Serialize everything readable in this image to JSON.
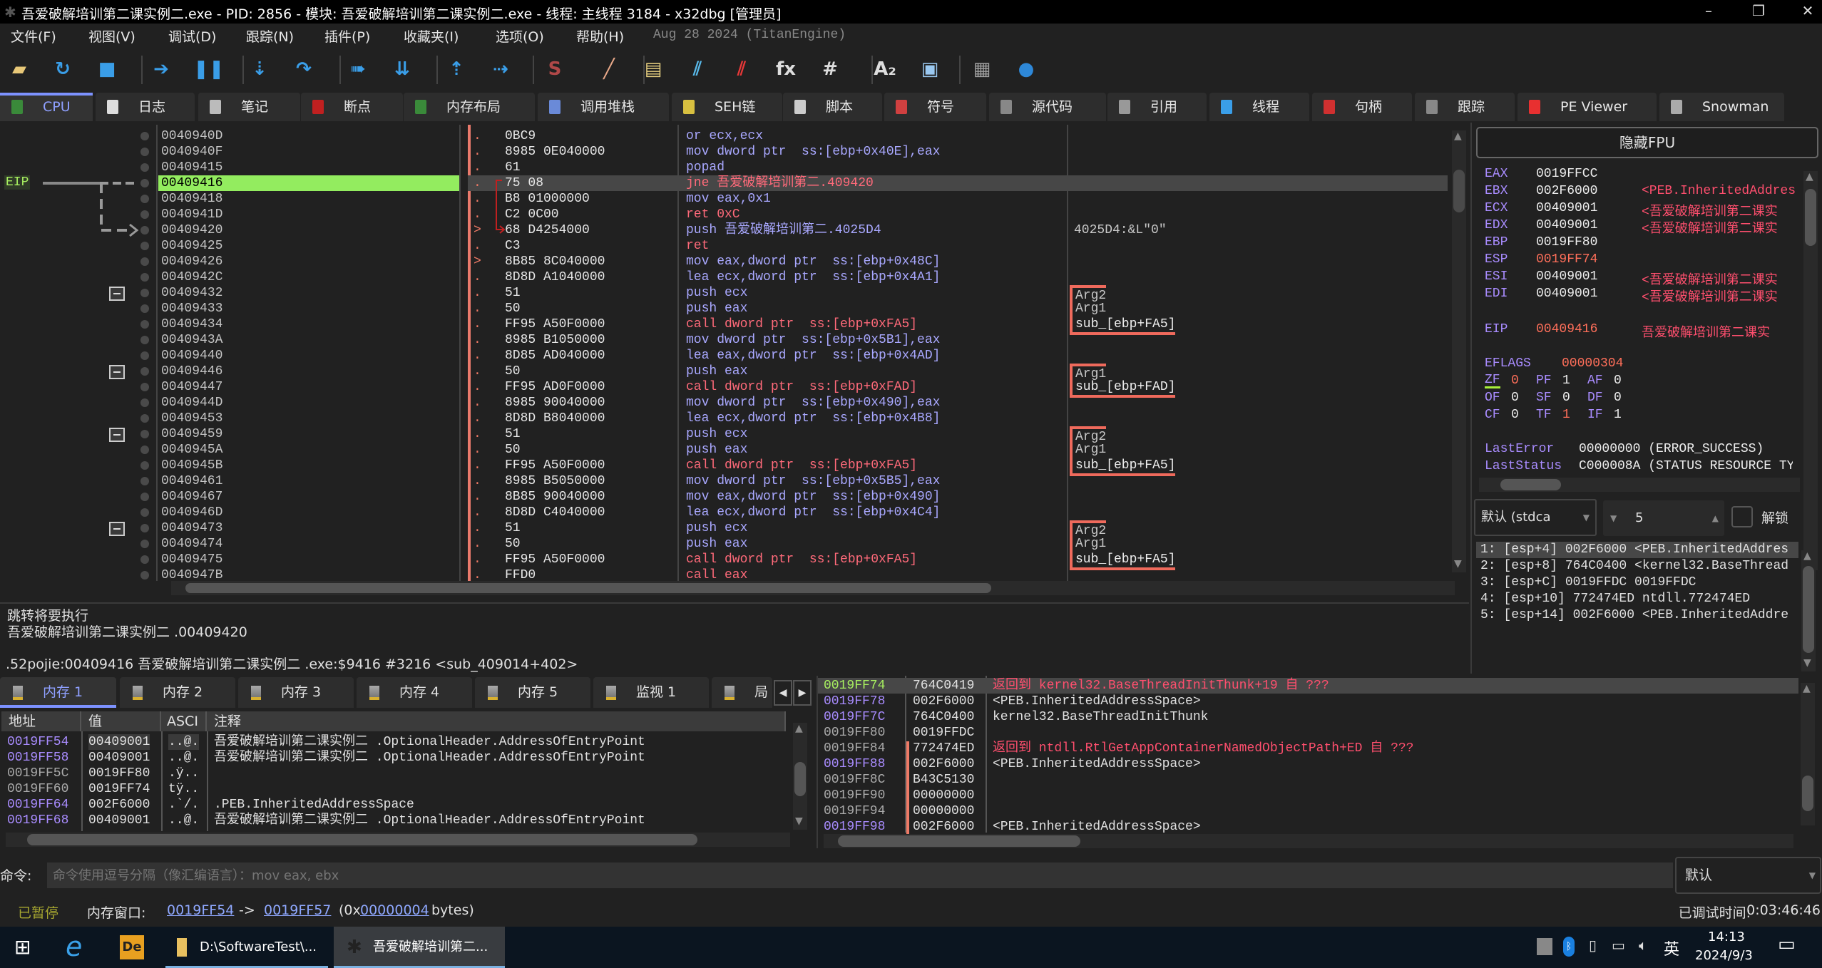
{
  "window": {
    "title": "吾爱破解培训第二课实例二.exe - PID: 2856 - 模块: 吾爱破解培训第二课实例二.exe - 线程: 主线程 3184 - x32dbg [管理员]",
    "app_icon": "bug-icon"
  },
  "menu": {
    "items": [
      "文件(F)",
      "视图(V)",
      "调试(D)",
      "跟踪(N)",
      "插件(P)",
      "收藏夹(I)",
      "选项(O)",
      "帮助(H)"
    ],
    "build_info": "Aug 28 2024 (TitanEngine)"
  },
  "toolbar": [
    {
      "icon": "open-icon",
      "glyph": "▰",
      "color": "#e8c878"
    },
    {
      "icon": "restart-icon",
      "glyph": "↻",
      "color": "#3a9ee8"
    },
    {
      "icon": "stop-icon",
      "glyph": "■",
      "color": "#3a9ee8"
    },
    {
      "icon": "run-icon",
      "glyph": "➔",
      "color": "#3a9ee8"
    },
    {
      "icon": "pause-icon",
      "glyph": "❚❚",
      "color": "#3a9ee8"
    },
    {
      "icon": "step-into-icon",
      "glyph": "⇣",
      "color": "#3a9ee8"
    },
    {
      "icon": "step-over-icon",
      "glyph": "↷",
      "color": "#3a9ee8"
    },
    {
      "icon": "trace-into-icon",
      "glyph": "➠",
      "color": "#3a9ee8"
    },
    {
      "icon": "trace-over-icon",
      "glyph": "⇊",
      "color": "#3a9ee8"
    },
    {
      "icon": "execute-till-return-icon",
      "glyph": "⇡",
      "color": "#3a9ee8"
    },
    {
      "icon": "run-to-user-code-icon",
      "glyph": "⇢",
      "color": "#3a9ee8"
    },
    {
      "icon": "scylla-icon",
      "glyph": "S",
      "color": "#b04848"
    },
    {
      "icon": "patch-icon",
      "glyph": "╱",
      "color": "#e8a888"
    },
    {
      "icon": "comments-icon",
      "glyph": "▤",
      "color": "#e8d080"
    },
    {
      "icon": "labels-icon",
      "glyph": "⫽",
      "color": "#58b8e8"
    },
    {
      "icon": "bookmarks-icon",
      "glyph": "⫽",
      "color": "#e83838"
    },
    {
      "icon": "functions-icon",
      "glyph": "fx",
      "color": "#dddddd"
    },
    {
      "icon": "hash-icon",
      "glyph": "#",
      "color": "#dddddd"
    },
    {
      "icon": "font-icon",
      "glyph": "A₂",
      "color": "#dddddd"
    },
    {
      "icon": "device-icon",
      "glyph": "▣",
      "color": "#9ac8f0"
    },
    {
      "icon": "calculator-icon",
      "glyph": "▦",
      "color": "#a0a0a0"
    },
    {
      "icon": "globe-icon",
      "glyph": "●",
      "color": "#2e88d8"
    }
  ],
  "tabs": [
    {
      "label": "CPU",
      "icon": "cpu-icon",
      "color": "#3a8a3a",
      "active": true
    },
    {
      "label": "日志",
      "icon": "log-icon",
      "color": "#ddd"
    },
    {
      "label": "笔记",
      "icon": "notes-icon",
      "color": "#bbb"
    },
    {
      "label": "断点",
      "icon": "breakpoint-icon",
      "color": "#c02020"
    },
    {
      "label": "内存布局",
      "icon": "memory-map-icon",
      "color": "#3a8a3a"
    },
    {
      "label": "调用堆栈",
      "icon": "call-stack-icon",
      "color": "#6a8ad8"
    },
    {
      "label": "SEH链",
      "icon": "seh-icon",
      "color": "#d8c040"
    },
    {
      "label": "脚本",
      "icon": "script-icon",
      "color": "#ccc"
    },
    {
      "label": "符号",
      "icon": "symbols-icon",
      "color": "#d04040"
    },
    {
      "label": "源代码",
      "icon": "source-icon",
      "color": "#888"
    },
    {
      "label": "引用",
      "icon": "references-icon",
      "color": "#999"
    },
    {
      "label": "线程",
      "icon": "threads-icon",
      "color": "#3a9ee8"
    },
    {
      "label": "句柄",
      "icon": "handles-icon",
      "color": "#d03030"
    },
    {
      "label": "跟踪",
      "icon": "trace-icon",
      "color": "#888"
    },
    {
      "label": "PE Viewer",
      "icon": "pe-viewer-icon",
      "color": "#e83030"
    },
    {
      "label": "Snowman",
      "icon": "snowman-icon",
      "color": "#aaa"
    }
  ],
  "disasm": {
    "eip_label": "EIP",
    "rows": [
      {
        "addr": "0040940D",
        "mark": ".",
        "bytes": "0BC9",
        "ins": "or ecx,ecx",
        "comment": ""
      },
      {
        "addr": "0040940F",
        "mark": ".",
        "bytes": "8985 0E040000",
        "ins": "mov dword ptr  ss:[ebp+0x40E],eax",
        "comment": ""
      },
      {
        "addr": "00409415",
        "mark": ".",
        "bytes": "61",
        "ins": "popad",
        "comment": ""
      },
      {
        "addr": "00409416",
        "mark": ".",
        "bytes": "75 08",
        "ins": "jne 吾爱破解培训第二.409420",
        "comment": "",
        "eip": true
      },
      {
        "addr": "00409418",
        "mark": ".",
        "bytes": "B8 01000000",
        "ins": "mov eax,0x1",
        "comment": ""
      },
      {
        "addr": "0040941D",
        "mark": ".",
        "bytes": "C2 0C00",
        "ins": "ret 0xC",
        "comment": ""
      },
      {
        "addr": "00409420",
        "mark": ">",
        "bytes": "68 D4254000",
        "ins": "push 吾爱破解培训第二.4025D4",
        "comment": "4025D4:&L\"0\""
      },
      {
        "addr": "00409425",
        "mark": ".",
        "bytes": "C3",
        "ins": "ret",
        "comment": ""
      },
      {
        "addr": "00409426",
        "mark": ">",
        "bytes": "8B85 8C040000",
        "ins": "mov eax,dword ptr  ss:[ebp+0x48C]",
        "comment": ""
      },
      {
        "addr": "0040942C",
        "mark": ".",
        "bytes": "8D8D A1040000",
        "ins": "lea ecx,dword ptr  ss:[ebp+0x4A1]",
        "comment": ""
      },
      {
        "addr": "00409432",
        "mark": ".",
        "bytes": "51",
        "ins": "push ecx",
        "comment": "Arg2",
        "bracket": "top",
        "fold": true
      },
      {
        "addr": "00409433",
        "mark": ".",
        "bytes": "50",
        "ins": "push eax",
        "comment": "Arg1",
        "bracket": "mid"
      },
      {
        "addr": "00409434",
        "mark": ".",
        "bytes": "FF95 A50F0000",
        "ins": "call dword ptr  ss:[ebp+0xFA5]",
        "comment": "sub_[ebp+FA5]",
        "bracket": "bottom"
      },
      {
        "addr": "0040943A",
        "mark": ".",
        "bytes": "8985 B1050000",
        "ins": "mov dword ptr  ss:[ebp+0x5B1],eax",
        "comment": ""
      },
      {
        "addr": "00409440",
        "mark": ".",
        "bytes": "8D85 AD040000",
        "ins": "lea eax,dword ptr  ss:[ebp+0x4AD]",
        "comment": ""
      },
      {
        "addr": "00409446",
        "mark": ".",
        "bytes": "50",
        "ins": "push eax",
        "comment": "Arg1",
        "bracket": "top",
        "fold": true
      },
      {
        "addr": "00409447",
        "mark": ".",
        "bytes": "FF95 AD0F0000",
        "ins": "call dword ptr  ss:[ebp+0xFAD]",
        "comment": "sub_[ebp+FAD]",
        "bracket": "bottom"
      },
      {
        "addr": "0040944D",
        "mark": ".",
        "bytes": "8985 90040000",
        "ins": "mov dword ptr  ss:[ebp+0x490],eax",
        "comment": ""
      },
      {
        "addr": "00409453",
        "mark": ".",
        "bytes": "8D8D B8040000",
        "ins": "lea ecx,dword ptr  ss:[ebp+0x4B8]",
        "comment": ""
      },
      {
        "addr": "00409459",
        "mark": ".",
        "bytes": "51",
        "ins": "push ecx",
        "comment": "Arg2",
        "bracket": "top",
        "fold": true
      },
      {
        "addr": "0040945A",
        "mark": ".",
        "bytes": "50",
        "ins": "push eax",
        "comment": "Arg1",
        "bracket": "mid"
      },
      {
        "addr": "0040945B",
        "mark": ".",
        "bytes": "FF95 A50F0000",
        "ins": "call dword ptr  ss:[ebp+0xFA5]",
        "comment": "sub_[ebp+FA5]",
        "bracket": "bottom"
      },
      {
        "addr": "00409461",
        "mark": ".",
        "bytes": "8985 B5050000",
        "ins": "mov dword ptr  ss:[ebp+0x5B5],eax",
        "comment": ""
      },
      {
        "addr": "00409467",
        "mark": ".",
        "bytes": "8B85 90040000",
        "ins": "mov eax,dword ptr  ss:[ebp+0x490]",
        "comment": ""
      },
      {
        "addr": "0040946D",
        "mark": ".",
        "bytes": "8D8D C4040000",
        "ins": "lea ecx,dword ptr  ss:[ebp+0x4C4]",
        "comment": ""
      },
      {
        "addr": "00409473",
        "mark": ".",
        "bytes": "51",
        "ins": "push ecx",
        "comment": "Arg2",
        "bracket": "top",
        "fold": true
      },
      {
        "addr": "00409474",
        "mark": ".",
        "bytes": "50",
        "ins": "push eax",
        "comment": "Arg1",
        "bracket": "mid"
      },
      {
        "addr": "00409475",
        "mark": ".",
        "bytes": "FF95 A50F0000",
        "ins": "call dword ptr  ss:[ebp+0xFA5]",
        "comment": "sub_[ebp+FA5]",
        "bracket": "bottom"
      },
      {
        "addr": "0040947B",
        "mark": ".",
        "bytes": "FFD0",
        "ins": "call eax",
        "comment": ""
      }
    ]
  },
  "info": {
    "lines": [
      "跳转将要执行",
      "吾爱破解培训第二课实例二 .00409420"
    ],
    "location": ".52pojie:00409416 吾爱破解培训第二课实例二 .exe:$9416 #3216 <sub_409014+402>"
  },
  "registers": {
    "hide_fpu": "隐藏FPU",
    "gp": [
      {
        "name": "EAX",
        "value": "0019FFCC",
        "comment": ""
      },
      {
        "name": "EBX",
        "value": "002F6000",
        "comment": "<PEB.InheritedAddres"
      },
      {
        "name": "ECX",
        "value": "00409001",
        "comment": "<吾爱破解培训第二课实"
      },
      {
        "name": "EDX",
        "value": "00409001",
        "comment": "<吾爱破解培训第二课实"
      },
      {
        "name": "EBP",
        "value": "0019FF80",
        "comment": ""
      },
      {
        "name": "ESP",
        "value": "0019FF74",
        "comment": "",
        "changed": true
      },
      {
        "name": "ESI",
        "value": "00409001",
        "comment": "<吾爱破解培训第二课实"
      },
      {
        "name": "EDI",
        "value": "00409001",
        "comment": "<吾爱破解培训第二课实"
      }
    ],
    "eip": {
      "name": "EIP",
      "value": "00409416",
      "comment": "吾爱破解培训第二课实"
    },
    "eflags": {
      "name": "EFLAGS",
      "value": "00000304"
    },
    "flags": [
      [
        {
          "name": "ZF",
          "value": "0",
          "changed": true
        },
        {
          "name": "PF",
          "value": "1"
        },
        {
          "name": "AF",
          "value": "0"
        }
      ],
      [
        {
          "name": "OF",
          "value": "0"
        },
        {
          "name": "SF",
          "value": "0"
        },
        {
          "name": "DF",
          "value": "0"
        }
      ],
      [
        {
          "name": "CF",
          "value": "0"
        },
        {
          "name": "TF",
          "value": "1",
          "changed": true
        },
        {
          "name": "IF",
          "value": "1"
        }
      ]
    ],
    "last_error": {
      "name": "LastError",
      "value": "00000000 (ERROR_SUCCESS)"
    },
    "last_status": {
      "name": "LastStatus",
      "value": "C000008A (STATUS RESOURCE TY"
    }
  },
  "callstack": {
    "convention": "默认 (stdca",
    "count": "5",
    "unlock": "解锁",
    "unlocked": false,
    "rows": [
      "1: [esp+4] 002F6000 <PEB.InheritedAddres",
      "2: [esp+8] 764C0400 <kernel32.BaseThread",
      "3: [esp+C] 0019FFDC 0019FFDC",
      "4: [esp+10] 772474ED ntdll.772474ED",
      "5: [esp+14] 002F6000 <PEB.InheritedAddre"
    ]
  },
  "dump_tabs": [
    {
      "label": "内存 1",
      "icon": "memory-icon",
      "active": true
    },
    {
      "label": "内存 2",
      "icon": "memory-icon"
    },
    {
      "label": "内存 3",
      "icon": "memory-icon"
    },
    {
      "label": "内存 4",
      "icon": "memory-icon"
    },
    {
      "label": "内存 5",
      "icon": "memory-icon"
    },
    {
      "label": "监视 1",
      "icon": "watch-icon"
    },
    {
      "label": "局",
      "icon": "locals-icon"
    }
  ],
  "dump": {
    "headers": [
      "地址",
      "值",
      "ASCI",
      "注释"
    ],
    "rows": [
      {
        "addr": "0019FF54",
        "value": "00409001",
        "ascii": "..@.",
        "comment": "吾爱破解培训第二课实例二 .OptionalHeader.AddressOfEntryPoint",
        "kind": "pointer"
      },
      {
        "addr": "0019FF58",
        "value": "00409001",
        "ascii": "..@.",
        "comment": "吾爱破解培训第二课实例二 .OptionalHeader.AddressOfEntryPoint",
        "kind": "pointer"
      },
      {
        "addr": "0019FF5C",
        "value": "0019FF80",
        "ascii": ".ÿ..",
        "comment": "",
        "kind": "plain"
      },
      {
        "addr": "0019FF60",
        "value": "0019FF74",
        "ascii": "tÿ..",
        "comment": "",
        "kind": "plain"
      },
      {
        "addr": "0019FF64",
        "value": "002F6000",
        "ascii": ".`/.",
        "comment": ".PEB.InheritedAddressSpace",
        "kind": "pointer"
      },
      {
        "addr": "0019FF68",
        "value": "00409001",
        "ascii": "..@.",
        "comment": "吾爱破解培训第二课实例二 .OptionalHeader.AddressOfEntryPoint",
        "kind": "pointer"
      }
    ]
  },
  "stack": {
    "rows": [
      {
        "addr": "0019FF74",
        "value": "764C0419",
        "comment": "返回到 kernel32.BaseThreadInitThunk+19 自 ???",
        "kind": "esp",
        "ret": true
      },
      {
        "addr": "0019FF78",
        "value": "002F6000",
        "comment": "<PEB.InheritedAddressSpace>",
        "kind": "pointer"
      },
      {
        "addr": "0019FF7C",
        "value": "764C0400",
        "comment": "kernel32.BaseThreadInitThunk",
        "kind": "pointer"
      },
      {
        "addr": "0019FF80",
        "value": "0019FFDC",
        "comment": "",
        "kind": "plain"
      },
      {
        "addr": "0019FF84",
        "value": "772474ED",
        "comment": "返回到 ntdll.RtlGetAppContainerNamedObjectPath+ED 自 ???",
        "kind": "plain",
        "ret": true
      },
      {
        "addr": "0019FF88",
        "value": "002F6000",
        "comment": "<PEB.InheritedAddressSpace>",
        "kind": "pointer"
      },
      {
        "addr": "0019FF8C",
        "value": "B43C5130",
        "comment": "",
        "kind": "plain"
      },
      {
        "addr": "0019FF90",
        "value": "00000000",
        "comment": "",
        "kind": "plain"
      },
      {
        "addr": "0019FF94",
        "value": "00000000",
        "comment": "",
        "kind": "plain"
      },
      {
        "addr": "0019FF98",
        "value": "002F6000",
        "comment": "<PEB.InheritedAddressSpace>",
        "kind": "pointer"
      }
    ]
  },
  "command": {
    "label": "命令:",
    "placeholder": "命令使用逗号分隔（像汇编语言）：mov eax, ebx",
    "mode": "默认"
  },
  "status": {
    "state": "已暂停",
    "mem_label": "内存窗口:",
    "from": "0019FF54",
    "arrow": "->",
    "to": "0019FF57",
    "size_prefix": "(0x",
    "size": "00000004",
    "size_suffix": "bytes)",
    "debug_time_label": "已调试时间:",
    "debug_time": "0:03:46:46"
  },
  "taskbar": {
    "items": [
      {
        "label": "D:\\SoftwareTest\\...",
        "icon": "folder-icon"
      },
      {
        "label": "吾爱破解培训第二...",
        "icon": "x32dbg-icon",
        "active": true
      }
    ],
    "ime": "英",
    "time": "14:13",
    "date": "2024/9/3"
  }
}
